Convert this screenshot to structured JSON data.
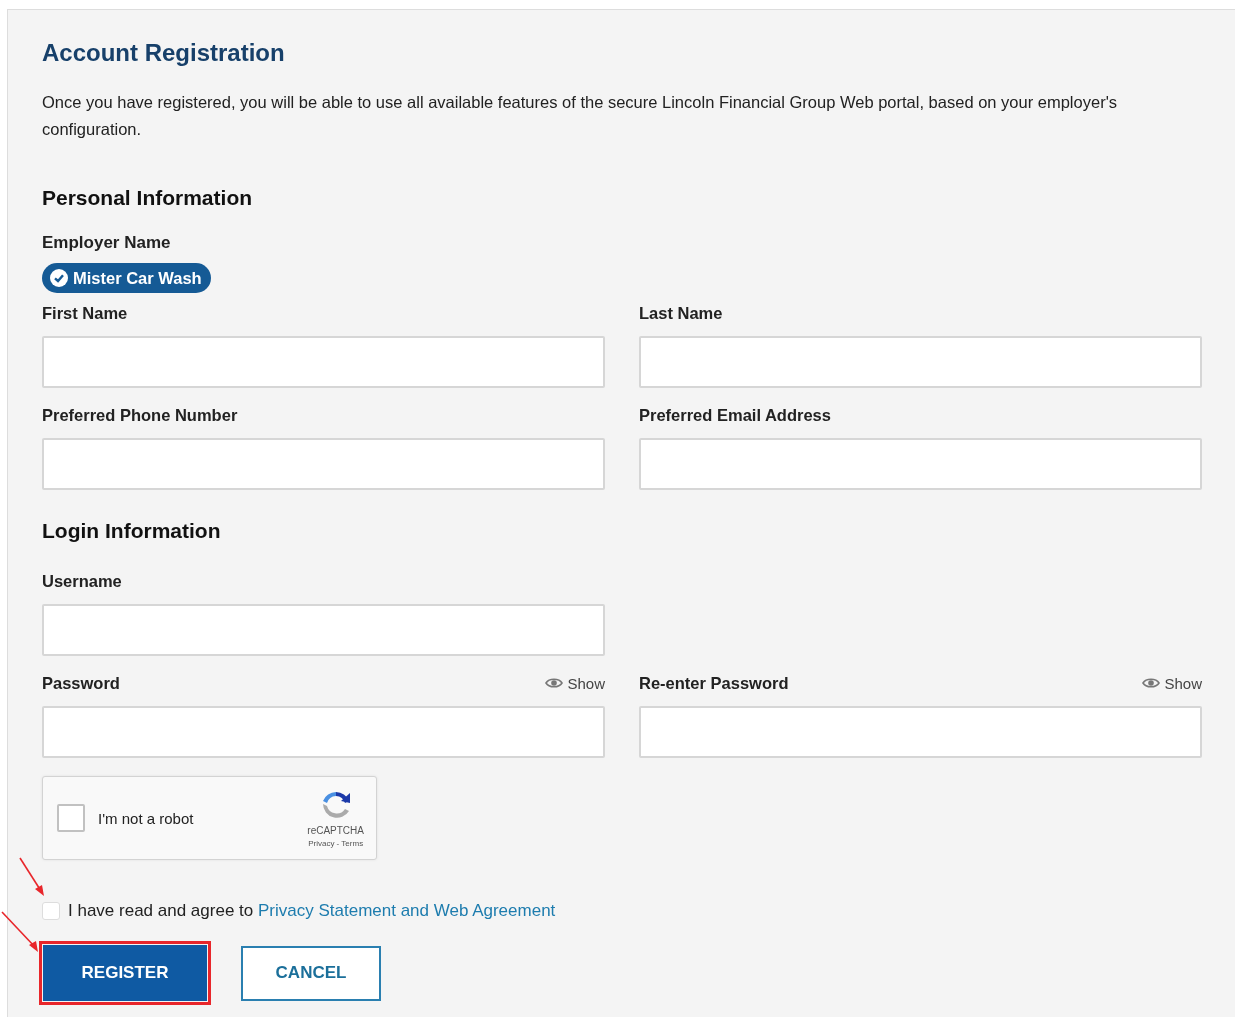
{
  "title": "Account Registration",
  "intro": "Once you have registered, you will be able to use all available features of the secure Lincoln Financial Group Web portal, based on your employer's configuration.",
  "personal": {
    "heading": "Personal Information",
    "employer_label": "Employer Name",
    "employer_chip": "Mister Car Wash",
    "rows": [
      [
        {
          "label": "First Name"
        },
        {
          "label": "Last Name"
        }
      ],
      [
        {
          "label": "Preferred Phone Number"
        },
        {
          "label": "Preferred Email Address"
        }
      ]
    ]
  },
  "login": {
    "heading": "Login Information",
    "rows": [
      [
        {
          "label": "Username"
        }
      ],
      [
        {
          "label": "Password",
          "toggle": "Show"
        },
        {
          "label": "Re-enter Password",
          "toggle": "Show"
        }
      ]
    ]
  },
  "captcha": {
    "checked": false,
    "label": "I'm not a robot",
    "brand": "reCAPTCHA",
    "links": "Privacy - Terms"
  },
  "agreement": {
    "checked": false,
    "highlighted": true,
    "text": "I have read and agree to ",
    "link": "Privacy Statement and Web Agreement"
  },
  "buttons": [
    {
      "label": "REGISTER",
      "kind": "primary",
      "highlighted": true
    },
    {
      "label": "CANCEL",
      "kind": "secondary",
      "highlighted": false
    }
  ]
}
